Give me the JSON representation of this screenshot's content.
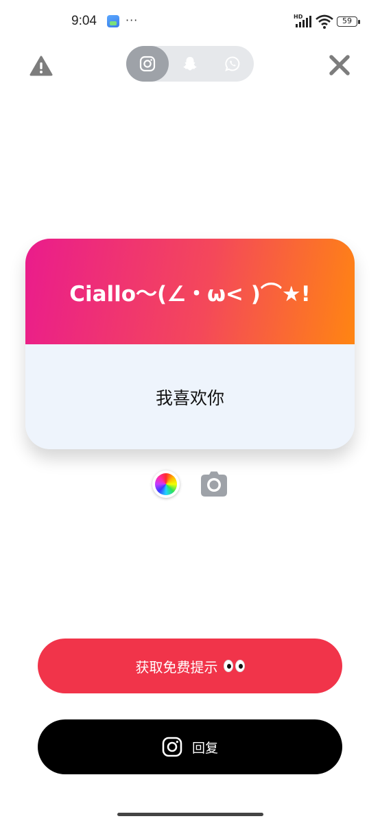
{
  "status_bar": {
    "time": "9:04",
    "more_indicator": "···",
    "network_badge": "HD",
    "battery_level": "59"
  },
  "toolbar": {
    "warning_icon": "warning-triangle-icon",
    "close_icon": "close-x-icon",
    "platforms": [
      {
        "name": "instagram",
        "icon": "instagram-icon",
        "selected": true
      },
      {
        "name": "snapchat",
        "icon": "snapchat-ghost-icon",
        "selected": false
      },
      {
        "name": "whatsapp",
        "icon": "whatsapp-icon",
        "selected": false
      }
    ]
  },
  "card": {
    "title": "Ciallo～(∠・ω< )⌒★!",
    "message": "我喜欢你",
    "gradient": {
      "start": "#ea1c8c",
      "mid": "#f4485a",
      "end": "#ff8512"
    },
    "message_background": "#eef4fc"
  },
  "tools": {
    "color_picker_icon": "color-wheel-icon",
    "camera_icon": "camera-icon"
  },
  "buttons": {
    "hint_label": "获取免费提示",
    "hint_emoji_icon": "eyes-emoji-icon",
    "hint_color": "#f1344a",
    "reply_label": "回复",
    "reply_icon": "instagram-icon",
    "reply_color": "#000000"
  }
}
